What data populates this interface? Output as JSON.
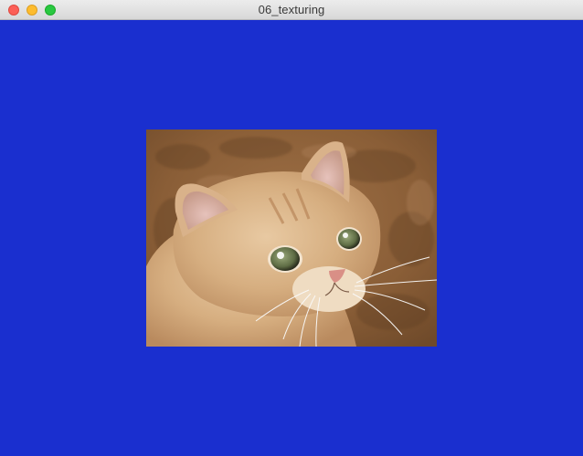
{
  "window": {
    "title": "06_texturing",
    "background_color": "#1a2fcf"
  },
  "titlebar": {
    "buttons": [
      {
        "name": "close",
        "color": "#fc5f57"
      },
      {
        "name": "minimize",
        "color": "#fdbc2e"
      },
      {
        "name": "zoom",
        "color": "#29c841"
      }
    ]
  },
  "scene": {
    "texture": "cat-photo"
  }
}
